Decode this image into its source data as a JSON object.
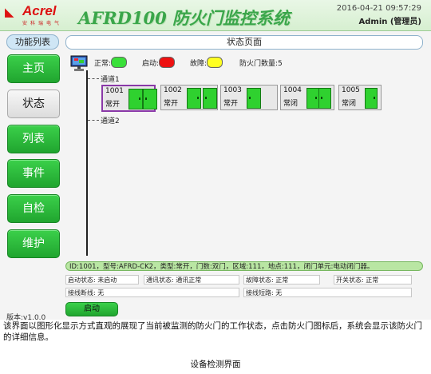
{
  "header": {
    "logo_text": "Acrel",
    "logo_sub": "安科瑞电气",
    "title": "AFRD100 防火门监控系统",
    "datetime": "2016-04-21 09:57:29",
    "user": "Admin (管理员)"
  },
  "sidebar": {
    "title": "功能列表",
    "items": [
      {
        "label": "主页"
      },
      {
        "label": "状态"
      },
      {
        "label": "列表"
      },
      {
        "label": "事件"
      },
      {
        "label": "自检"
      },
      {
        "label": "维护"
      }
    ],
    "active_item": "状态",
    "version": "版本:v1.0.0"
  },
  "page_title": "状态页面",
  "legend": {
    "normal": "正常:",
    "started": "启动:",
    "fault": "故障:",
    "door_count": "防火门数量:5",
    "colors": {
      "normal": "#39e039",
      "started": "#ee1111",
      "fault": "#ffff22"
    }
  },
  "channels": [
    {
      "label": "通道1"
    },
    {
      "label": "通道2"
    }
  ],
  "doors": [
    {
      "id": "1001",
      "status": "常开",
      "type": "double",
      "selected": true
    },
    {
      "id": "1002",
      "status": "常开",
      "type": "double",
      "selected": false
    },
    {
      "id": "1003",
      "status": "常开",
      "type": "single",
      "selected": false
    },
    {
      "id": "1004",
      "status": "常闭",
      "type": "double-closed",
      "selected": false
    },
    {
      "id": "1005",
      "status": "常闭",
      "type": "single-closed",
      "selected": false
    }
  ],
  "info_bar": "ID:1001，型号:AFRD-CK2，类型:常开，门数:双门，区域:111，地点:111，闭门单元:电动闭门器。",
  "details": {
    "start_state": "启动状态: 未启动",
    "comm_state": "通讯状态: 通讯正常",
    "fault_state": "故障状态: 正常",
    "switch_state": "开关状态: 正常",
    "line_break": "接线断线: 无",
    "line_short": "接线短路: 无"
  },
  "start_button": "启动",
  "caption": "该界面以图形化显示方式直观的展现了当前被监测的防火门的工作状态，点击防火门图标后，系统会显示该防火门的详细信息。",
  "figure_caption": "设备检测界面"
}
